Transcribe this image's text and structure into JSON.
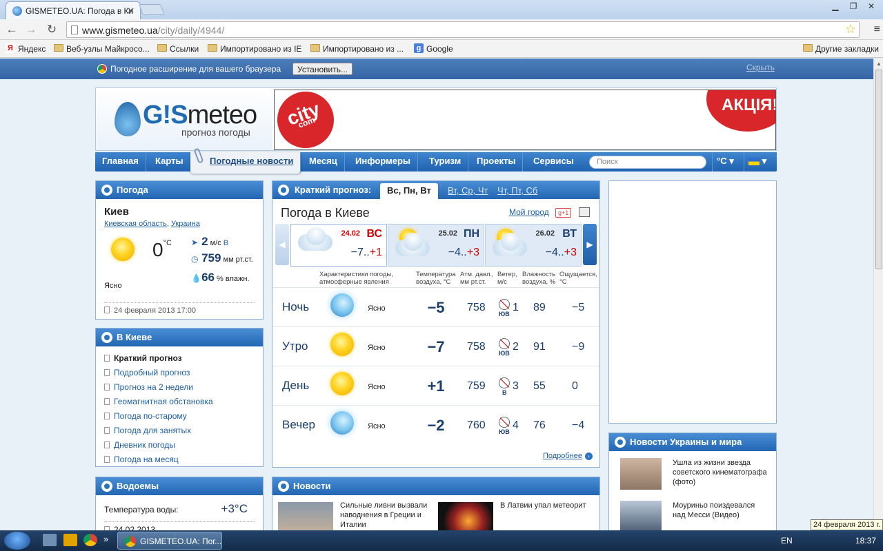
{
  "browser": {
    "tab_title": "GISMETEO.UA: Погода в Ки",
    "url_host": "www.gismeteo.ua",
    "url_path": "/city/daily/4944/",
    "bookmarks": [
      "Яндекс",
      "Веб-узлы Майкросо...",
      "Ссылки",
      "Импортировано из IE",
      "Импортировано из ...",
      "Google"
    ],
    "other_bookmarks": "Другие закладки"
  },
  "extbar": {
    "message": "Погодное расширение для вашего браузера",
    "install": "Установить...",
    "hide": "Скрыть"
  },
  "header": {
    "logo_word_prefix": "G!S",
    "logo_word_rest": "meteo",
    "logo_sub": "прогноз погоды",
    "banner_left": "city",
    "banner_left_sub": "com",
    "banner_right": "АКЦІЯ!"
  },
  "menu": {
    "items": [
      "Главная",
      "Карты",
      "Погодные новости",
      "Месяц",
      "Информеры",
      "Туризм",
      "Проекты",
      "Сервисы"
    ],
    "search_placeholder": "Поиск",
    "unit": "°C ▾",
    "flag_arrow": "▾"
  },
  "weather": {
    "title": "Погода",
    "city": "Киев",
    "region": "Киевская область",
    "country": "Украина",
    "temp": "0",
    "temp_unit": "°C",
    "wind_value": "2",
    "wind_unit": "м/с",
    "wind_dir": "В",
    "pressure_value": "759",
    "pressure_unit": "мм рт.ст.",
    "humidity_value": "66",
    "humidity_unit": "% влажн.",
    "condition": "Ясно",
    "updated": "24 февраля 2013 17:00"
  },
  "kiev": {
    "title": "В Киеве",
    "links": [
      "Краткий прогноз",
      "Подробный прогноз",
      "Прогноз на 2 недели",
      "Геомагнитная обстановка",
      "Погода по-старому",
      "Погода для занятых",
      "Дневник погоды",
      "Погода на месяц"
    ]
  },
  "water": {
    "title": "Водоемы",
    "label": "Температура воды:",
    "value": "+3°C",
    "date": "24.02.2013"
  },
  "forecast": {
    "header": "Краткий прогноз:",
    "tabs": [
      "Вс, Пн, Вт",
      "Вт, Ср, Чт",
      "Чт, Пт, Сб"
    ],
    "title": "Погода в Киеве",
    "my_city": "Мой город",
    "gplus": "g+1",
    "days": [
      {
        "date": "24.02",
        "weekday": "ВС",
        "min": "−7..",
        "max": "+1"
      },
      {
        "date": "25.02",
        "weekday": "ПН",
        "min": "−4..",
        "max": "+3"
      },
      {
        "date": "26.02",
        "weekday": "ВТ",
        "min": "−4..",
        "max": "+3"
      }
    ],
    "columns": [
      "Характеристики погоды, атмосферные явления",
      "Температура воздуха, °C",
      "Атм. давл., мм рт.ст.",
      "Ветер, м/с",
      "Влажность воздуха, %",
      "Ощущается, °C"
    ],
    "rows": [
      {
        "part": "Ночь",
        "icon": "moon",
        "desc": "Ясно",
        "temp": "−5",
        "pressure": "758",
        "wind_dir": "ЮВ",
        "wind": "1",
        "humidity": "89",
        "feels": "−5"
      },
      {
        "part": "Утро",
        "icon": "sun",
        "desc": "Ясно",
        "temp": "−7",
        "pressure": "758",
        "wind_dir": "ЮВ",
        "wind": "2",
        "humidity": "91",
        "feels": "−9"
      },
      {
        "part": "День",
        "icon": "sun",
        "desc": "Ясно",
        "temp": "+1",
        "pressure": "759",
        "wind_dir": "В",
        "wind": "3",
        "humidity": "55",
        "feels": "0"
      },
      {
        "part": "Вечер",
        "icon": "moon",
        "desc": "Ясно",
        "temp": "−2",
        "pressure": "760",
        "wind_dir": "ЮВ",
        "wind": "4",
        "humidity": "76",
        "feels": "−4"
      }
    ],
    "more": "Подробнее"
  },
  "news": {
    "title": "Новости",
    "items": [
      "Сильные ливни вызвали наводнения в Греции и Италии",
      "В Латвии упал метеорит"
    ]
  },
  "world_news": {
    "title": "Новости Украины и мира",
    "items": [
      "Ушла из жизни звезда советского кинематографа (фото)",
      "Моуриньо поиздевался над Месси (Видео)"
    ]
  },
  "taskbar": {
    "app": "GISMETEO.UA: Пог...",
    "lang": "EN",
    "time": "18:37",
    "tooltip": "24 февраля 2013 г."
  },
  "colors": {
    "brand": "#2366b3",
    "accent_red": "#cc0000"
  }
}
